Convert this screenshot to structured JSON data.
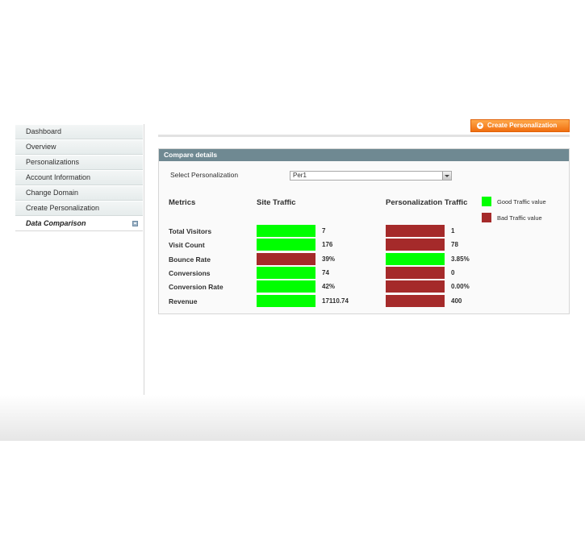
{
  "sidebar": {
    "items": [
      {
        "label": "Dashboard"
      },
      {
        "label": "Overview"
      },
      {
        "label": "Personalizations"
      },
      {
        "label": "Account Information"
      },
      {
        "label": "Change Domain"
      },
      {
        "label": "Create Personalization"
      },
      {
        "label": "Data Comparison",
        "active": true
      }
    ]
  },
  "header": {
    "create_button_label": "Create Personalization"
  },
  "panel": {
    "title": "Compare details",
    "select_label": "Select Personalization",
    "select_value": "Per1",
    "col_metrics": "Metrics",
    "col_site": "Site Traffic",
    "col_personalization": "Personalization Traffic",
    "legend": {
      "good_label": "Good Traffic value",
      "bad_label": "Bad Traffic value",
      "good_color": "#00ff00",
      "bad_color": "#a52a2a"
    },
    "rows": [
      {
        "metric": "Total Visitors",
        "site_value": "7",
        "site_status": "good",
        "pers_value": "1",
        "pers_status": "bad"
      },
      {
        "metric": "Visit Count",
        "site_value": "176",
        "site_status": "good",
        "pers_value": "78",
        "pers_status": "bad"
      },
      {
        "metric": "Bounce Rate",
        "site_value": "39%",
        "site_status": "bad",
        "pers_value": "3.85%",
        "pers_status": "good"
      },
      {
        "metric": "Conversions",
        "site_value": "74",
        "site_status": "good",
        "pers_value": "0",
        "pers_status": "bad"
      },
      {
        "metric": "Conversion Rate",
        "site_value": "42%",
        "site_status": "good",
        "pers_value": "0.00%",
        "pers_status": "bad"
      },
      {
        "metric": "Revenue",
        "site_value": "17110.74",
        "site_status": "good",
        "pers_value": "400",
        "pers_status": "bad"
      }
    ]
  }
}
